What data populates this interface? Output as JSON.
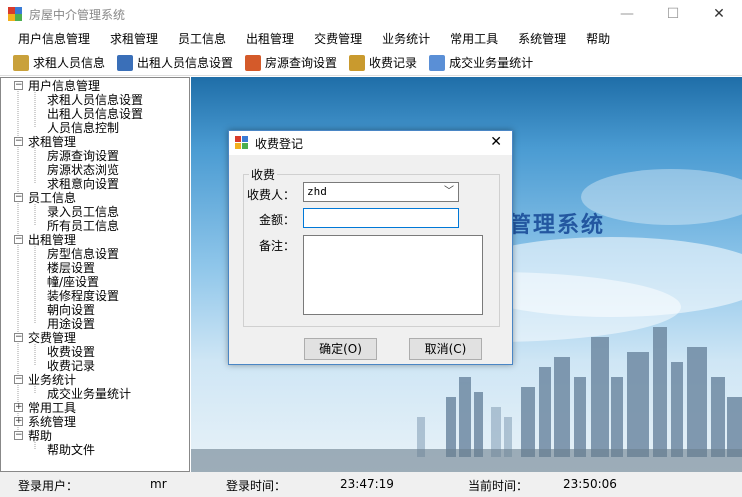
{
  "window": {
    "title": "房屋中介管理系统",
    "min": "—",
    "max": "☐",
    "close": "✕"
  },
  "menu": [
    "用户信息管理",
    "求租管理",
    "员工信息",
    "出租管理",
    "交费管理",
    "业务统计",
    "常用工具",
    "系统管理",
    "帮助"
  ],
  "toolbar": [
    {
      "label": "求租人员信息",
      "icon": "person-icon",
      "color": "#c9a13b"
    },
    {
      "label": "出租人员信息设置",
      "icon": "person-blue-icon",
      "color": "#3a6fb8"
    },
    {
      "label": "房源查询设置",
      "icon": "house-icon",
      "color": "#d45a2a"
    },
    {
      "label": "收费记录",
      "icon": "money-icon",
      "color": "#c99a2e"
    },
    {
      "label": "成交业务量统计",
      "icon": "chart-icon",
      "color": "#5a8fd6"
    }
  ],
  "tree": [
    {
      "label": "用户信息管理",
      "level": 0,
      "expander": "−"
    },
    {
      "label": "求租人员信息设置",
      "level": 1
    },
    {
      "label": "出租人员信息设置",
      "level": 1
    },
    {
      "label": "人员信息控制",
      "level": 1
    },
    {
      "label": "求租管理",
      "level": 0,
      "expander": "−"
    },
    {
      "label": "房源查询设置",
      "level": 1
    },
    {
      "label": "房源状态浏览",
      "level": 1
    },
    {
      "label": "求租意向设置",
      "level": 1
    },
    {
      "label": "员工信息",
      "level": 0,
      "expander": "−"
    },
    {
      "label": "录入员工信息",
      "level": 1
    },
    {
      "label": "所有员工信息",
      "level": 1
    },
    {
      "label": "出租管理",
      "level": 0,
      "expander": "−"
    },
    {
      "label": "房型信息设置",
      "level": 1
    },
    {
      "label": "楼层设置",
      "level": 1
    },
    {
      "label": "幢/座设置",
      "level": 1
    },
    {
      "label": "装修程度设置",
      "level": 1
    },
    {
      "label": "朝向设置",
      "level": 1
    },
    {
      "label": "用途设置",
      "level": 1
    },
    {
      "label": "交费管理",
      "level": 0,
      "expander": "−"
    },
    {
      "label": "收费设置",
      "level": 1
    },
    {
      "label": "收费记录",
      "level": 1
    },
    {
      "label": "业务统计",
      "level": 0,
      "expander": "−"
    },
    {
      "label": "成交业务量统计",
      "level": 1
    },
    {
      "label": "常用工具",
      "level": 0,
      "expander": "+"
    },
    {
      "label": "系统管理",
      "level": 0,
      "expander": "+"
    },
    {
      "label": "帮助",
      "level": 0,
      "expander": "−"
    },
    {
      "label": "帮助文件",
      "level": 1
    }
  ],
  "background": {
    "title_fragment": "管理系统"
  },
  "status": {
    "user_label": "登录用户：",
    "user_value": "mr",
    "login_time_label": "登录时间：",
    "login_time_value": "23:47:19",
    "current_time_label": "当前时间：",
    "current_time_value": "23:50:06"
  },
  "dialog": {
    "title": "收费登记",
    "group_label": "收费",
    "payer_label": "收费人：",
    "payer_value": "zhd",
    "amount_label": "金额：",
    "amount_value": "",
    "note_label": "备注：",
    "note_value": "",
    "ok_label": "确定(O)",
    "cancel_label": "取消(C)"
  }
}
